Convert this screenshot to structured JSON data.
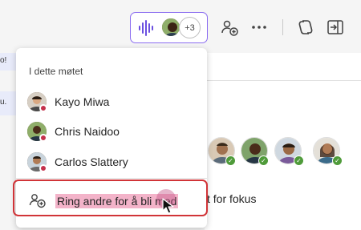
{
  "topbar": {
    "participant_overflow": "+3",
    "icons": [
      "waveform-icon",
      "add-people-icon",
      "more-options-icon",
      "copilot-icon",
      "share-panel-icon"
    ]
  },
  "sliver": {
    "frag1": "o!",
    "frag2": "u."
  },
  "dropdown": {
    "title": "I dette møtet",
    "people": [
      {
        "name": "Kayo Miwa",
        "status": "busy"
      },
      {
        "name": "Chris Naidoo",
        "status": "busy"
      },
      {
        "name": "Carlos Slattery",
        "status": "busy"
      }
    ],
    "action_label": "Ring andre for å bli med"
  },
  "main": {
    "bottom_text": "t for fokus"
  },
  "colors": {
    "accent": "#8a6cf0",
    "highlight": "#d13438",
    "busy": "#c4314b",
    "available": "#4f9b3a"
  }
}
